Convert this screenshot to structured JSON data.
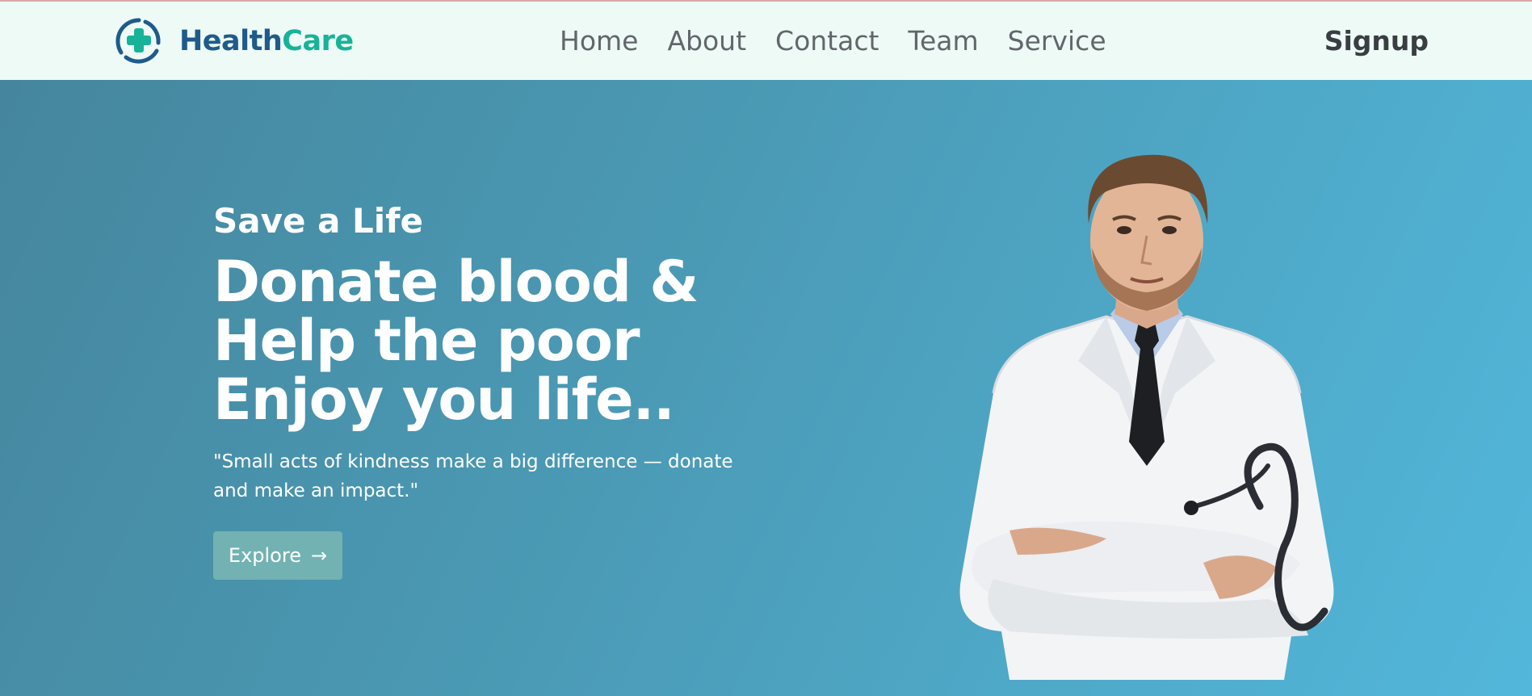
{
  "brand": {
    "name_part1": "Health",
    "name_part2": "Care",
    "logo_icon": "medical-cross-icon",
    "color_primary": "#1f5b8a",
    "color_accent": "#17b398"
  },
  "nav": {
    "items": [
      {
        "label": "Home"
      },
      {
        "label": "About"
      },
      {
        "label": "Contact"
      },
      {
        "label": "Team"
      },
      {
        "label": "Service"
      }
    ],
    "signup_label": "Signup"
  },
  "hero": {
    "kicker": "Save a Life",
    "headline_lines": [
      "Donate blood &",
      "Help the poor",
      "Enjoy you life.."
    ],
    "quote": "\"Small acts of kindness make a big difference — donate and make an impact.\"",
    "cta_label": "Explore",
    "cta_icon": "arrow-right-icon",
    "cta_arrow": "→",
    "image": "doctor-portrait",
    "gradient_colors": [
      "#45869d",
      "#52b7db"
    ]
  }
}
